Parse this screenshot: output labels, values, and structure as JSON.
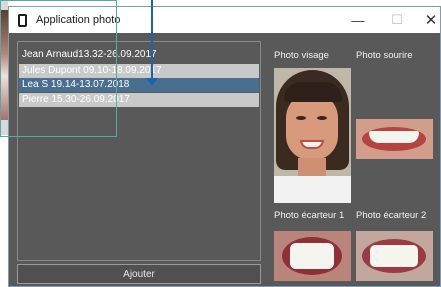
{
  "window": {
    "title": "Application photo",
    "icon": "phone-icon",
    "controls": {
      "minimize": "—",
      "maximize": "☐",
      "close": "✕"
    }
  },
  "patients": [
    {
      "label": "Jean Arnaud13.32-26.09.2017",
      "state": "normal"
    },
    {
      "label": "Jules Dupont 09.10-18.09.2017",
      "state": "highlighted"
    },
    {
      "label": "Lea S 19.14-13.07.2018",
      "state": "selected"
    },
    {
      "label": "Pierre 15.30-26.09.2017",
      "state": "highlighted"
    }
  ],
  "add_button": "Ajouter",
  "photos": {
    "visage": "Photo visage",
    "sourire": "Photo sourire",
    "ecarteur1": "Photo écarteur 1",
    "ecarteur2": "Photo écarteur 2"
  },
  "colors": {
    "window_bg": "#595959",
    "selected": "#4a6f8e",
    "highlight": "#c9c9c9",
    "cursor": "#1a64b4"
  }
}
